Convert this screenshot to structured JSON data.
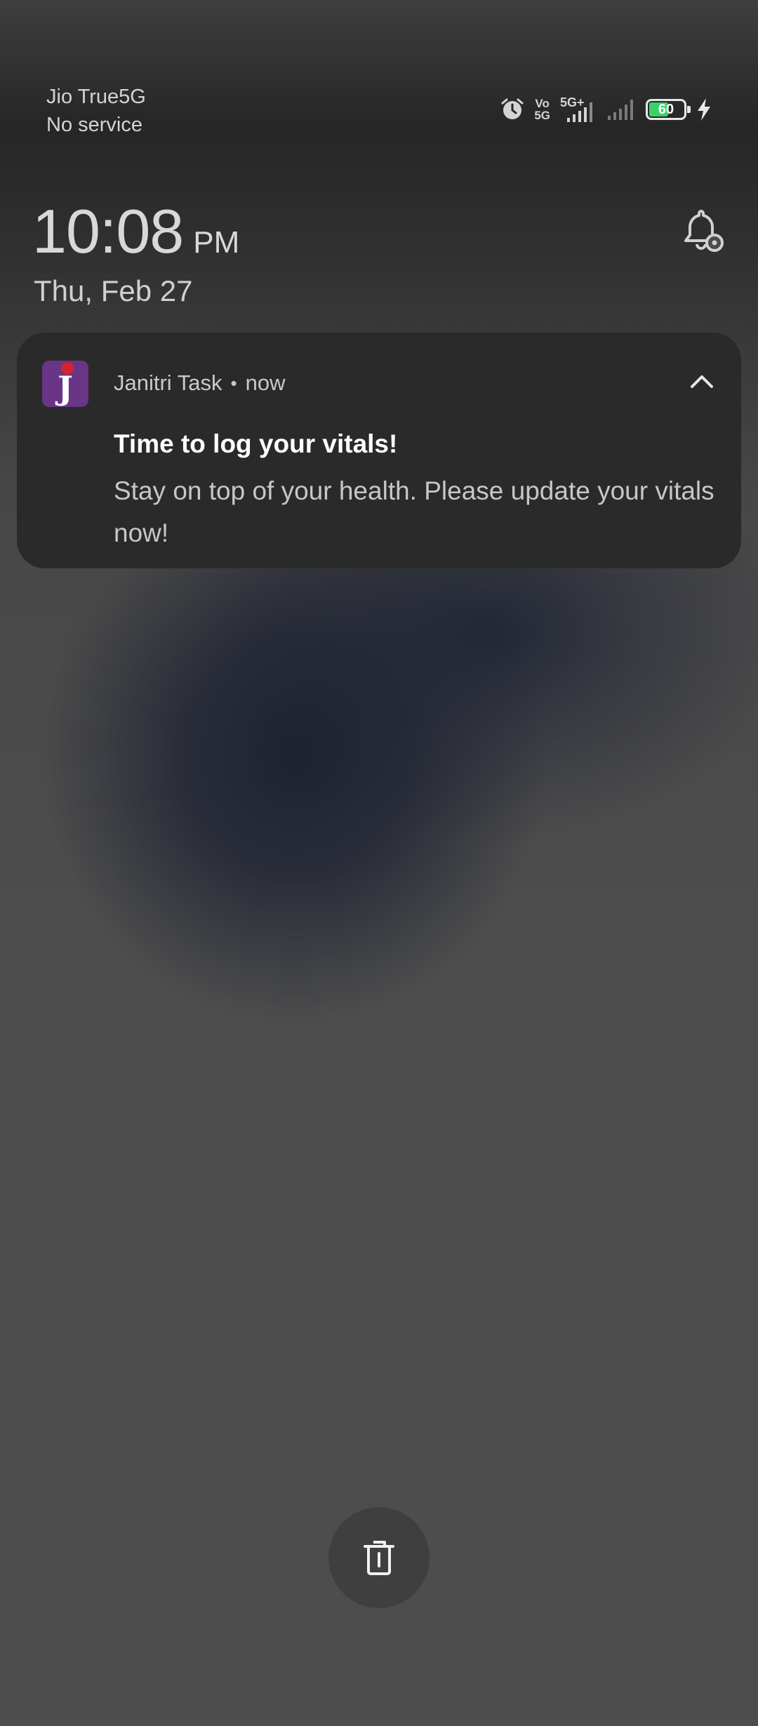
{
  "status_bar": {
    "carrier_name": "Jio True5G",
    "carrier_status": "No service",
    "volte_top": "Vo",
    "volte_bottom": "5G",
    "network_type": "5G+",
    "battery_percent": "60",
    "battery_level": 0.6,
    "battery_color": "#3ad16a",
    "icons": [
      "alarm-icon",
      "volte-icon",
      "signal-5g-icon",
      "signal-empty-icon",
      "battery-icon",
      "charging-bolt-icon"
    ]
  },
  "lock": {
    "time": "10:08",
    "ampm": "PM",
    "date": "Thu, Feb 27",
    "settings_icon": "bell-settings-icon"
  },
  "notification": {
    "app_icon_letter": "J",
    "app_name": "Janitri Task",
    "separator": "•",
    "time_ago": "now",
    "title": "Time to log your vitals!",
    "body": "Stay on top of your health. Please update your vitals now!",
    "collapse_icon": "chevron-up-icon",
    "background": "#2a2a2a",
    "app_icon_color": "#6a3586"
  },
  "actions": {
    "clear_icon": "trash-icon"
  }
}
